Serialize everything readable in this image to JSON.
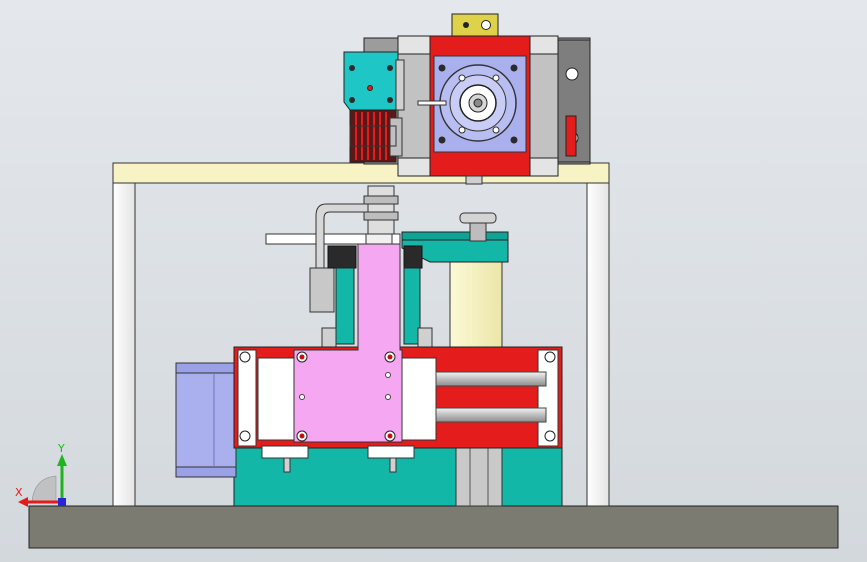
{
  "triad": {
    "x_label": "X",
    "y_label": "Y",
    "x_color": "#e31b1b",
    "y_color": "#1fb51f",
    "z_color": "#2626d6"
  },
  "colors": {
    "base_plate": "#7b7b72",
    "frame_top": "#f7f3c4",
    "frame_leg": "#ffffff",
    "red_part": "#e41c1c",
    "teal_part": "#12b7a8",
    "pink_part": "#f5a7f2",
    "lavender_part": "#aab0ee",
    "yellow_pillar": "#f6f2bb",
    "cyan_block": "#1ec6c6",
    "gray_housing": "#9c9c9c",
    "yellow_tab": "#ddd24a"
  }
}
